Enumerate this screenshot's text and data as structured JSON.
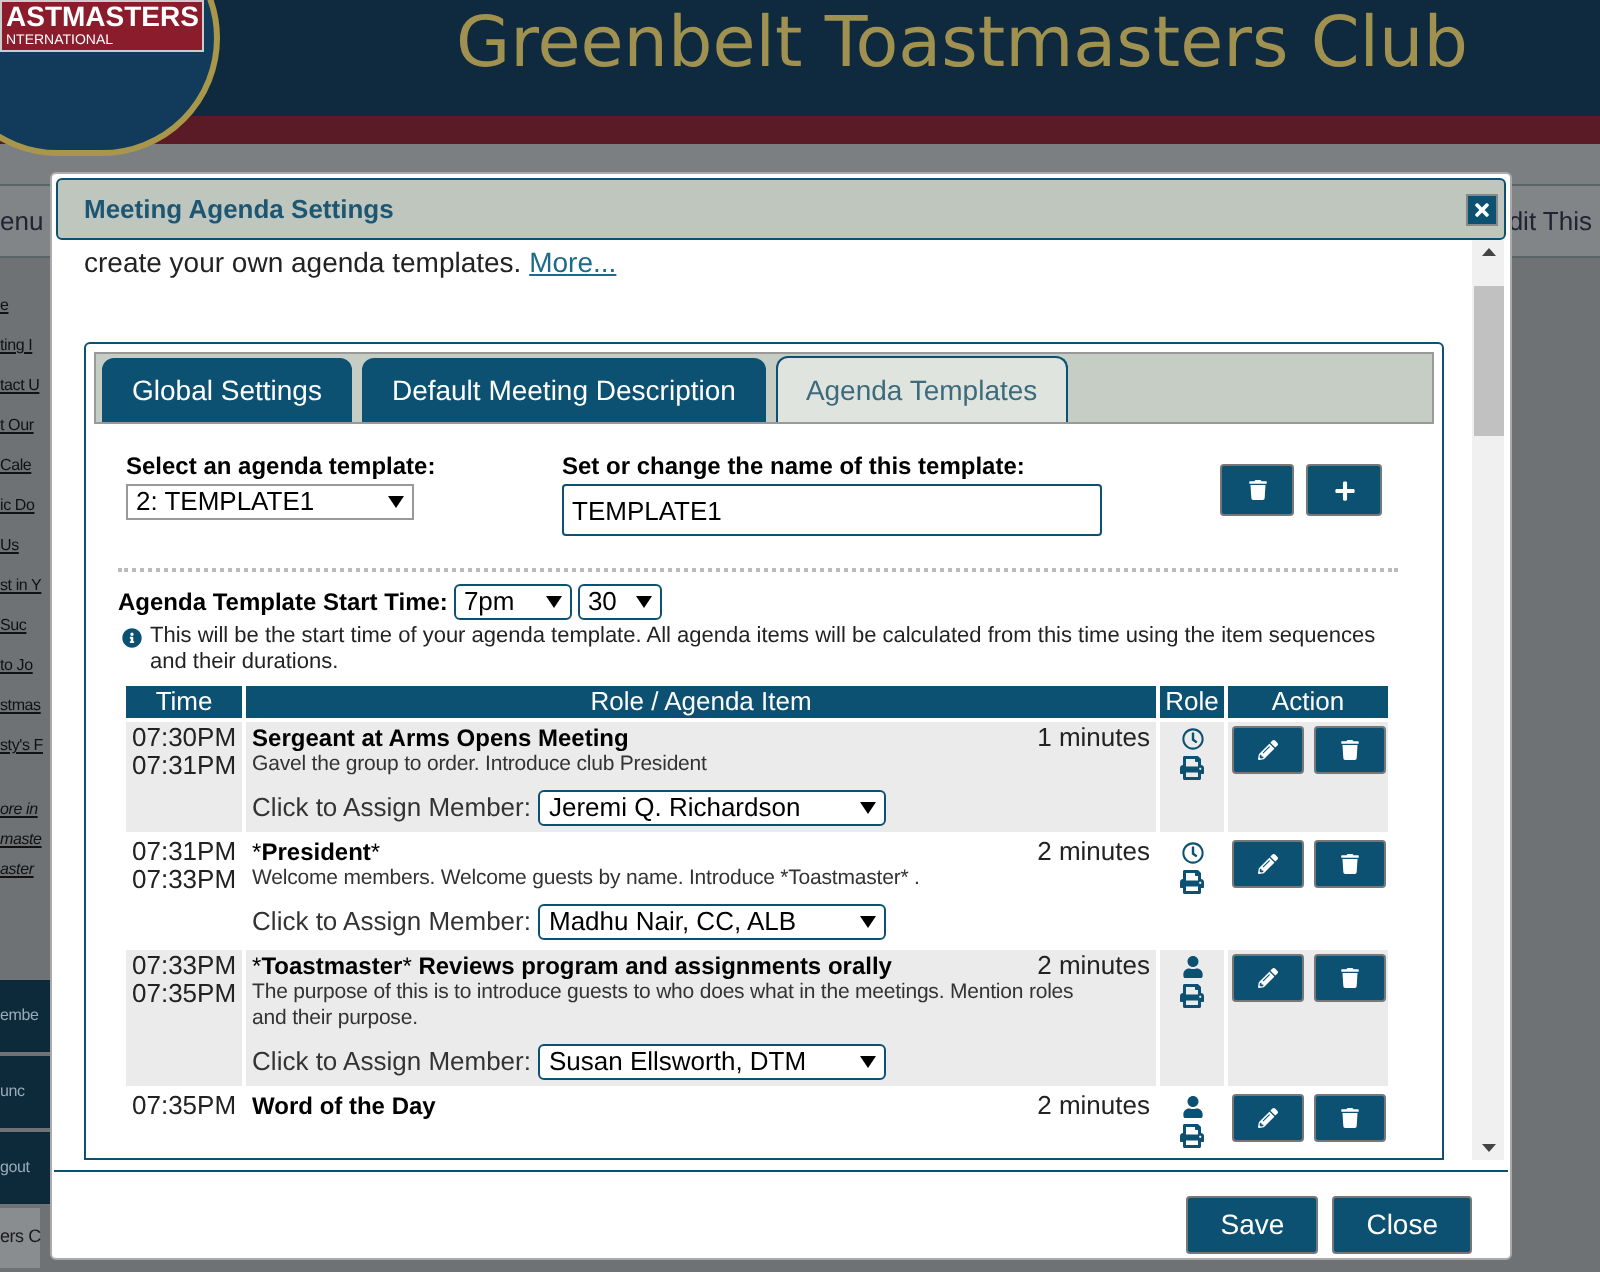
{
  "background_page": {
    "logo_lines": [
      "ASTMASTERS",
      "NTERNATIONAL"
    ],
    "site_title": "Greenbelt Toastmasters Club",
    "menu_bar": {
      "left": "enu",
      "right": "dit This"
    },
    "sidebar_links": [
      {
        "kind": "link",
        "text": "e"
      },
      {
        "kind": "link",
        "text": "ting I"
      },
      {
        "kind": "link",
        "text": "tact U"
      },
      {
        "kind": "link",
        "text": "t Our"
      },
      {
        "kind": "link",
        "text": "Cale"
      },
      {
        "kind": "link",
        "text": "ic Do"
      },
      {
        "kind": "link",
        "text": "Us"
      },
      {
        "kind": "link",
        "text": "st in Y"
      },
      {
        "kind": "link",
        "text": "Suc"
      },
      {
        "kind": "link",
        "text": "to Jo"
      },
      {
        "kind": "link",
        "text": "stmas"
      },
      {
        "kind": "link",
        "text": "sty's F"
      },
      {
        "kind": "note",
        "text": "ore in"
      },
      {
        "kind": "note",
        "text": "maste"
      },
      {
        "kind": "note",
        "text": "aster"
      },
      {
        "kind": "button",
        "text": "embe"
      },
      {
        "kind": "button",
        "text": "unc"
      },
      {
        "kind": "button",
        "text": "gout"
      },
      {
        "kind": "footer",
        "text": "ers C"
      }
    ]
  },
  "dialog": {
    "title": "Meeting Agenda Settings",
    "intro": "create your own agenda templates.",
    "intro_link": "More...",
    "tabs": [
      {
        "label": "Global Settings",
        "selected": false
      },
      {
        "label": "Default Meeting Description",
        "selected": false
      },
      {
        "label": "Agenda Templates",
        "selected": true
      }
    ],
    "template_select": {
      "label": "Select an agenda template:",
      "value": "2: TEMPLATE1"
    },
    "template_name": {
      "label": "Set or change the name of this template:",
      "value": "TEMPLATE1"
    },
    "start_time": {
      "label": "Agenda Template Start Time:",
      "hour": "7pm",
      "minute": "30"
    },
    "info": "This will be the start time of your agenda template. All agenda items will be calculated from this time using the item sequences and their durations.",
    "table": {
      "columns": [
        "Time",
        "Role / Agenda Item",
        "Role",
        "Action"
      ],
      "rows": [
        {
          "start": "07:30PM",
          "end": "07:31PM",
          "title_parts": [
            {
              "text": "Sergeant at Arms Opens Meeting",
              "bold": true
            }
          ],
          "duration": "1 minutes",
          "description": "Gavel the group to order. Introduce club President",
          "assign_label": "Click to Assign Member:",
          "member": "Jeremi Q. Richardson",
          "kind": "clock"
        },
        {
          "start": "07:31PM",
          "end": "07:33PM",
          "title_parts": [
            {
              "text": "*",
              "bold": false
            },
            {
              "text": "President",
              "bold": true
            },
            {
              "text": "*",
              "bold": false
            }
          ],
          "duration": "2 minutes",
          "description": "Welcome members. Welcome guests by name. Introduce *Toastmaster* .",
          "assign_label": "Click to Assign Member:",
          "member": "Madhu Nair, CC, ALB",
          "kind": "clock"
        },
        {
          "start": "07:33PM",
          "end": "07:35PM",
          "title_parts": [
            {
              "text": "*",
              "bold": false
            },
            {
              "text": "Toastmaster",
              "bold": true
            },
            {
              "text": "*",
              "bold": false
            },
            {
              "text": " Reviews program and assignments orally",
              "bold": true
            }
          ],
          "duration": "2 minutes",
          "description": "The purpose of this is to introduce guests to who does what in the meetings. Mention roles and their purpose.",
          "assign_label": "Click to Assign Member:",
          "member": "Susan Ellsworth, DTM",
          "kind": "person"
        },
        {
          "start": "07:35PM",
          "title_parts": [
            {
              "text": "Word of the Day",
              "bold": true
            }
          ],
          "duration": "2 minutes",
          "kind": "person"
        }
      ]
    },
    "buttons": [
      "Save",
      "Close"
    ]
  }
}
